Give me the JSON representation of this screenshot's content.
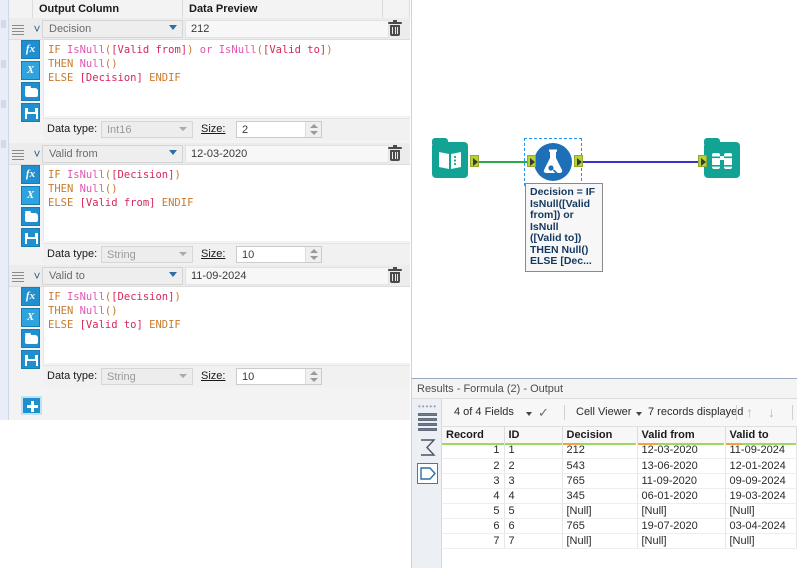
{
  "config_panel": {
    "headers": {
      "pre": "",
      "output_column": "Output Column",
      "data_preview": "Data Preview",
      "trail": ""
    },
    "add_button_label": "+",
    "blocks": [
      {
        "output_column": "Decision",
        "data_preview": "212",
        "formula_lines": [
          [
            {
              "t": "IF ",
              "c": "kw"
            },
            {
              "t": "IsNull",
              "c": "fn"
            },
            {
              "t": "(",
              "c": "pl"
            },
            {
              "t": "[Valid from]",
              "c": "fld"
            },
            {
              "t": ") ",
              "c": "pl"
            },
            {
              "t": "or",
              "c": "op"
            },
            {
              "t": " ",
              "c": "pl"
            },
            {
              "t": "IsNull",
              "c": "fn"
            },
            {
              "t": "(",
              "c": "pl"
            },
            {
              "t": "[Valid to]",
              "c": "fld"
            },
            {
              "t": ")",
              "c": "pl"
            }
          ],
          [
            {
              "t": "THEN ",
              "c": "kw"
            },
            {
              "t": "Null",
              "c": "fn"
            },
            {
              "t": "()",
              "c": "pl"
            }
          ],
          [
            {
              "t": "ELSE ",
              "c": "kw"
            },
            {
              "t": "[Decision]",
              "c": "fld"
            },
            {
              "t": " ENDIF",
              "c": "kw"
            }
          ]
        ],
        "data_type_label": "Data type:",
        "data_type": "Int16",
        "size_label": "Size:",
        "size": "2"
      },
      {
        "output_column": "Valid from",
        "data_preview": "12-03-2020",
        "formula_lines": [
          [
            {
              "t": "IF ",
              "c": "kw"
            },
            {
              "t": "IsNull",
              "c": "fn"
            },
            {
              "t": "(",
              "c": "pl"
            },
            {
              "t": "[Decision]",
              "c": "fld"
            },
            {
              "t": ")",
              "c": "pl"
            }
          ],
          [
            {
              "t": "THEN ",
              "c": "kw"
            },
            {
              "t": "Null",
              "c": "fn"
            },
            {
              "t": "()",
              "c": "pl"
            }
          ],
          [
            {
              "t": "ELSE ",
              "c": "kw"
            },
            {
              "t": "[Valid from]",
              "c": "fld"
            },
            {
              "t": " ENDIF",
              "c": "kw"
            }
          ]
        ],
        "data_type_label": "Data type:",
        "data_type": "String",
        "size_label": "Size:",
        "size": "10"
      },
      {
        "output_column": "Valid to",
        "data_preview": "11-09-2024",
        "formula_lines": [
          [
            {
              "t": "IF ",
              "c": "kw"
            },
            {
              "t": "IsNull",
              "c": "fn"
            },
            {
              "t": "(",
              "c": "pl"
            },
            {
              "t": "[Decision]",
              "c": "fld"
            },
            {
              "t": ")",
              "c": "pl"
            }
          ],
          [
            {
              "t": "THEN ",
              "c": "kw"
            },
            {
              "t": "Null",
              "c": "fn"
            },
            {
              "t": "()",
              "c": "pl"
            }
          ],
          [
            {
              "t": "ELSE ",
              "c": "kw"
            },
            {
              "t": "[Valid to]",
              "c": "fld"
            },
            {
              "t": " ENDIF",
              "c": "kw"
            }
          ]
        ],
        "data_type_label": "Data type:",
        "data_type": "String",
        "size_label": "Size:",
        "size": "10"
      }
    ],
    "tool_icons": [
      "fx-icon",
      "x-variable-icon",
      "open-folder-icon",
      "save-floppy-icon"
    ]
  },
  "canvas": {
    "nodes": [
      {
        "name": "input-data-node",
        "icon": "book-icon",
        "color": "#13a394"
      },
      {
        "name": "formula-node",
        "icon": "flask-icon",
        "color": "#1e6fb8"
      },
      {
        "name": "browse-node",
        "icon": "binoculars-icon",
        "color": "#13a394"
      }
    ],
    "tooltip": "Decision = IF IsNull([Valid from]) or IsNull ([Valid to]) THEN Null() ELSE [Dec...",
    "tooltip_lines": [
      "Decision = IF",
      "IsNull([Valid",
      "from]) or IsNull",
      "([Valid to])",
      "THEN Null()",
      "ELSE [Dec..."
    ],
    "connection_colors": {
      "input_to_formula": "#2aa84a",
      "formula_to_browse": "#3b2fd0"
    }
  },
  "results": {
    "title": "Results - Formula (2) - Output",
    "toolbar": {
      "fields": "4 of 4 Fields",
      "check_icon": "checkmark-icon",
      "cell_viewer": "Cell Viewer",
      "records": "7 records displayed",
      "up_icon": "arrow-up-icon",
      "down_icon": "arrow-down-icon"
    },
    "rail_icons": [
      "list-view-icon",
      "summary-sigma-icon",
      "data-tag-icon"
    ],
    "table": {
      "columns": [
        "Record",
        "ID",
        "Decision",
        "Valid from",
        "Valid to"
      ],
      "column_quality": [
        {
          "good": "#9ada5e",
          "warn": ""
        },
        {
          "good": "#9ada5e",
          "warn": ""
        },
        {
          "good": "#9ada5e",
          "warn": "#f2a33c"
        },
        {
          "good": "#9ada5e",
          "warn": "#f2a33c"
        },
        {
          "good": "#9ada5e",
          "warn": "#f2a33c"
        }
      ],
      "rows": [
        {
          "record": "1",
          "id": "1",
          "decision": "212",
          "valid_from": "12-03-2020",
          "valid_to": "11-09-2024",
          "null_cols": []
        },
        {
          "record": "2",
          "id": "2",
          "decision": "543",
          "valid_from": "13-06-2020",
          "valid_to": "12-01-2024",
          "null_cols": []
        },
        {
          "record": "3",
          "id": "3",
          "decision": "765",
          "valid_from": "11-09-2020",
          "valid_to": "09-09-2024",
          "null_cols": []
        },
        {
          "record": "4",
          "id": "4",
          "decision": "345",
          "valid_from": "06-01-2020",
          "valid_to": "19-03-2024",
          "null_cols": []
        },
        {
          "record": "5",
          "id": "5",
          "decision": "[Null]",
          "valid_from": "[Null]",
          "valid_to": "[Null]",
          "null_cols": [
            "decision",
            "valid_from",
            "valid_to"
          ]
        },
        {
          "record": "6",
          "id": "6",
          "decision": "765",
          "valid_from": "19-07-2020",
          "valid_to": "03-04-2024",
          "null_cols": []
        },
        {
          "record": "7",
          "id": "7",
          "decision": "[Null]",
          "valid_from": "[Null]",
          "valid_to": "[Null]",
          "null_cols": [
            "decision",
            "valid_from",
            "valid_to"
          ]
        }
      ]
    }
  }
}
